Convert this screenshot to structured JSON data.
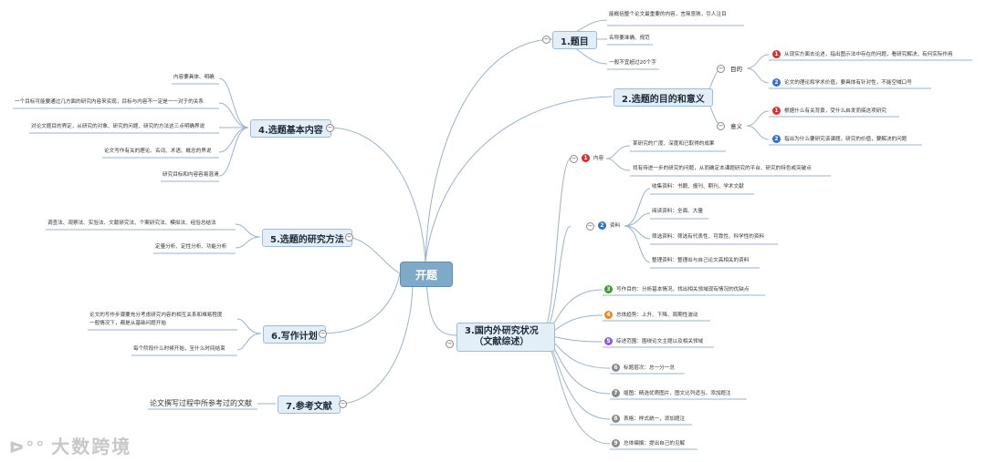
{
  "root": "开题",
  "t1": {
    "title": "1.题目",
    "items": [
      "能概括整个论文最重要的内容，言简意赅，引人注目",
      "名称要准确、规范",
      "一般不宜超过20个字"
    ]
  },
  "t2": {
    "title": "2.选题的目的和意义",
    "purpose_label": "目的",
    "purpose": [
      "从现实方面去论述，指出图示法中存在的问题，看研究解决，有何实际作用",
      "论文的理论和学术价值，要具体有针对性，不能空喊口号"
    ],
    "meaning_label": "意义",
    "meaning": [
      "根据什么有关背景，受什么启发而搞这项研究",
      "指出为什么要研究该课题，研究的价值，要解决的问题"
    ]
  },
  "t3": {
    "title_line1": "3.国内外研究状况",
    "title_line2": "（文献综述）",
    "content_label": "内容",
    "content": [
      "某研究的广度、深度和已取得的成果",
      "找有待进一步的研究的问题，从而确定本课题研究的平台、研究的特色或突破点"
    ],
    "material_label": "资料",
    "material": [
      "收集资料：书籍、报刊、期刊、学术文献",
      "阅读资料：全面、大量",
      "筛选资料：筛选有代表性、可靠性、科学性的资料",
      "整理资料：整理出与自己论文高相关的资料"
    ],
    "others": [
      "写作目的：分析基本情况，找出相关领域现有情况的优缺点",
      "总体趋势：上升、下降、周期性波动",
      "综述范围：围绕论文主题以及相关领域",
      "标题层次：总一分一总",
      "插图：精选优质图片，图文比列适当，添加题注",
      "表格：样式统一，添加题注",
      "总体编撰：提出自己的见解"
    ]
  },
  "t4": {
    "title": "4.选题基本内容",
    "items": [
      "内容要具体、明确",
      "一个目标可能要通过几方面的研究内容来实现，目标与内容不一定是一一对于的关系",
      "对论文题目的界定，从研究的对象、研究的问题、研究的方法这三点明确界说",
      "论文写作有关的理论、名词、术语、概念的界说",
      "研究目标和内容容易混淆"
    ]
  },
  "t5": {
    "title": "5.选题的研究方法",
    "items": [
      "调查法、观察法、实验法、文献研究法、个案研究法、模拟法、经验总结法",
      "定量分析、定性分析、功能分析"
    ]
  },
  "t6": {
    "title": "6.写作计划",
    "items": [
      "论文的写作步骤要充分考虑研究内容的相互关系和难易程度",
      "一般情况下，都是从基础问题开始",
      "每个阶段什么时候开始，至什么时间结束"
    ]
  },
  "t7": {
    "title": "7.参考文献",
    "items": [
      "论文撰写过程中所参考过的文献"
    ]
  },
  "badges": [
    "1",
    "2",
    "3",
    "4",
    "5",
    "6",
    "7",
    "8",
    "9"
  ],
  "colors": {
    "red": "#d9302c",
    "blue": "#2f6fd0",
    "green": "#3a9a2a",
    "orange": "#e98a1e",
    "purple": "#8a5fd0",
    "gray": "#8a8a8a",
    "line": "#9bb3c8",
    "topic_bg": "#e3eef8"
  },
  "watermark": "大数跨境"
}
